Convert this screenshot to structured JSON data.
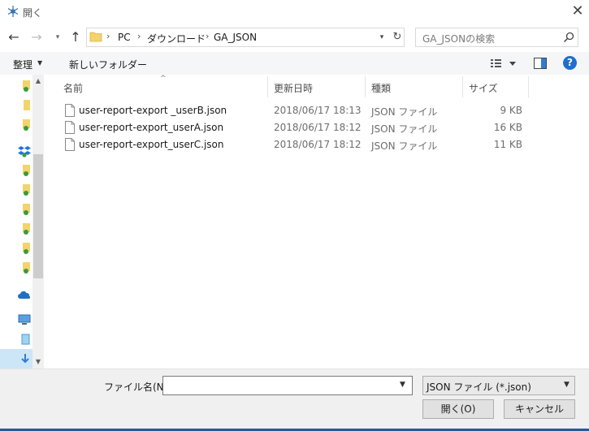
{
  "window": {
    "title": "開く"
  },
  "address": {
    "crumbs": [
      "PC",
      "ダウンロード",
      "GA_JSON"
    ]
  },
  "search": {
    "placeholder": "GA_JSONの検索"
  },
  "toolbar": {
    "organize_label": "整理",
    "new_folder_label": "新しいフォルダー",
    "help_label": "?"
  },
  "columns": {
    "name": "名前",
    "date": "更新日時",
    "type": "種類",
    "size": "サイズ"
  },
  "files": [
    {
      "name": "user-report-export _userB.json",
      "date": "2018/06/17 18:13",
      "type": "JSON ファイル",
      "size": "9 KB"
    },
    {
      "name": "user-report-export_userA.json",
      "date": "2018/06/17 18:12",
      "type": "JSON ファイル",
      "size": "16 KB"
    },
    {
      "name": "user-report-export_userC.json",
      "date": "2018/06/17 18:12",
      "type": "JSON ファイル",
      "size": "11 KB"
    }
  ],
  "footer": {
    "filename_label": "ファイル名(N):",
    "filename_value": "",
    "filetype_value": "JSON ファイル (*.json)",
    "open_label": "開く(O)",
    "cancel_label": "キャンセル"
  },
  "colors": {
    "accent": "#2b579a",
    "help": "#1e6fd0",
    "selection": "#cde6f7",
    "folder": "#f3d36b"
  }
}
